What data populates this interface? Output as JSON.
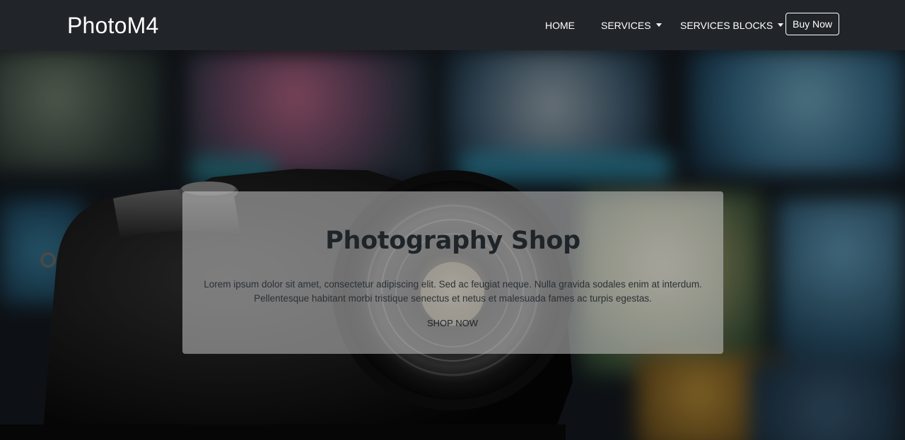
{
  "brand": "PhotoM4",
  "nav": {
    "home": "HOME",
    "services": "SERVICES",
    "services_blocks": "SERVICES BLOCKS",
    "buy_now": "Buy Now"
  },
  "hero": {
    "title": "Photography Shop",
    "text_line1": "Lorem ipsum dolor sit amet, consectetur adipiscing elit. Sed ac feugiat neque. Nulla gravida sodales enim at interdum.",
    "text_line2": "Pellentesque habitant morbi tristique senectus et netus et malesuada fames ac turpis egestas.",
    "cta": "SHOP NOW"
  },
  "colors": {
    "navbar_bg": "#212529",
    "nav_text": "#ffffff",
    "card_bg": "rgba(200,200,200,0.55)",
    "title_text": "#1f2428"
  },
  "icons": {
    "dropdown": "caret-down-icon"
  }
}
